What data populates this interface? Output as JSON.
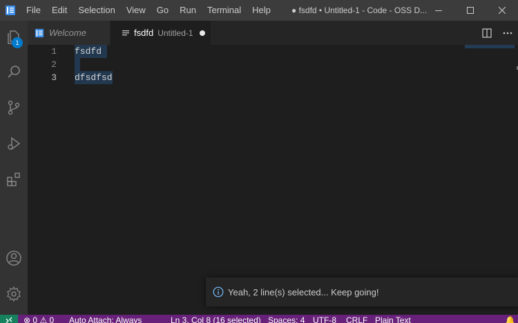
{
  "window": {
    "title": "● fsdfd • Untitled-1 - Code - OSS D..."
  },
  "menu": {
    "items": [
      "File",
      "Edit",
      "Selection",
      "View",
      "Go",
      "Run",
      "Terminal",
      "Help"
    ]
  },
  "activity_bar": {
    "explorer_badge": "1",
    "icons": [
      "explorer-icon",
      "search-icon",
      "source-control-icon",
      "run-debug-icon",
      "extensions-icon",
      "account-icon",
      "settings-gear-icon"
    ]
  },
  "tabs": [
    {
      "label": "Welcome",
      "active": false
    },
    {
      "label": "fsdfd",
      "description": "Untitled-1",
      "active": true,
      "dirty": true
    }
  ],
  "editor": {
    "lines": [
      {
        "number": "1",
        "text": "fsdfd"
      },
      {
        "number": "2",
        "text": ""
      },
      {
        "number": "3",
        "text": "dfsdfsd"
      }
    ],
    "cursor_line": 3
  },
  "notification": {
    "message": "Yeah, 2 line(s) selected... Keep going!"
  },
  "status_bar": {
    "problems": "0",
    "warnings": "0",
    "auto_attach": "Auto Attach: Always",
    "position": "Ln 3, Col 8 (16 selected)",
    "indent": "Spaces: 4",
    "encoding": "UTF-8",
    "eol": "CRLF",
    "language": "Plain Text"
  },
  "colors": {
    "accent": "#007acc",
    "status_bar": "#68217a",
    "remote": "#16825d",
    "selection": "#264f78"
  }
}
